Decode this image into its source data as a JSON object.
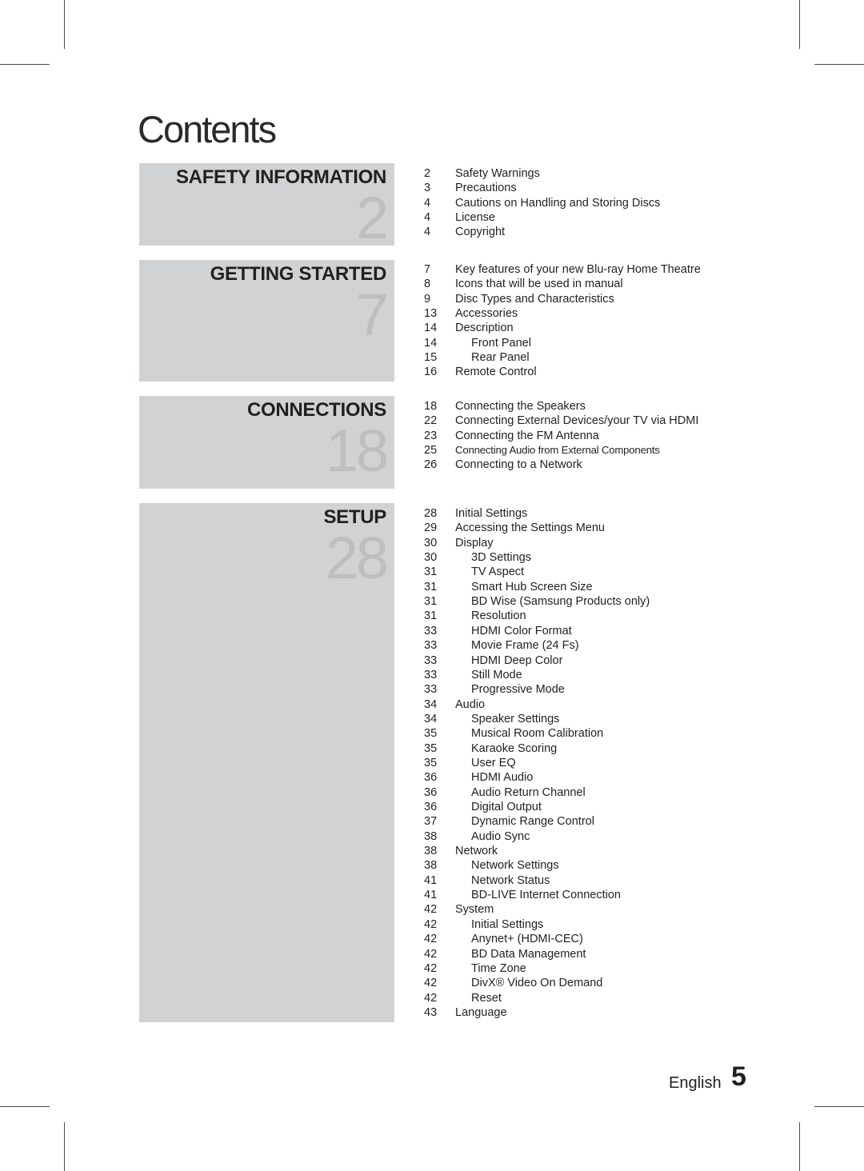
{
  "page": {
    "title": "Contents",
    "footer_language": "English",
    "footer_page_number": "5"
  },
  "sections": [
    {
      "label": "SAFETY INFORMATION",
      "start_page": "2",
      "entries": [
        {
          "page": "2",
          "text": "Safety Warnings",
          "level": 1
        },
        {
          "page": "3",
          "text": "Precautions",
          "level": 1
        },
        {
          "page": "4",
          "text": "Cautions on Handling and Storing Discs",
          "level": 1
        },
        {
          "page": "4",
          "text": "License",
          "level": 1
        },
        {
          "page": "4",
          "text": "Copyright",
          "level": 1
        }
      ]
    },
    {
      "label": "GETTING STARTED",
      "start_page": "7",
      "entries": [
        {
          "page": "7",
          "text": "Key features of your new Blu-ray Home Theatre",
          "level": 1
        },
        {
          "page": "8",
          "text": "Icons that will be used in manual",
          "level": 1
        },
        {
          "page": "9",
          "text": "Disc Types and Characteristics",
          "level": 1
        },
        {
          "page": "13",
          "text": "Accessories",
          "level": 1
        },
        {
          "page": "14",
          "text": "Description",
          "level": 1
        },
        {
          "page": "14",
          "text": "Front Panel",
          "level": 2
        },
        {
          "page": "15",
          "text": "Rear Panel",
          "level": 2
        },
        {
          "page": "16",
          "text": "Remote Control",
          "level": 1
        }
      ]
    },
    {
      "label": "CONNECTIONS",
      "start_page": "18",
      "entries": [
        {
          "page": "18",
          "text": "Connecting the Speakers",
          "level": 1
        },
        {
          "page": "22",
          "text": "Connecting External Devices/your TV via HDMI",
          "level": 1
        },
        {
          "page": "23",
          "text": "Connecting the FM Antenna",
          "level": 1
        },
        {
          "page": "25",
          "text": "Connecting Audio from External Components",
          "level": 1,
          "small": true
        },
        {
          "page": "26",
          "text": "Connecting to a Network",
          "level": 1
        }
      ]
    },
    {
      "label": "SETUP",
      "start_page": "28",
      "entries": [
        {
          "page": "28",
          "text": "Initial Settings",
          "level": 1
        },
        {
          "page": "29",
          "text": "Accessing the Settings Menu",
          "level": 1
        },
        {
          "page": "30",
          "text": "Display",
          "level": 1
        },
        {
          "page": "30",
          "text": "3D Settings",
          "level": 2
        },
        {
          "page": "31",
          "text": "TV Aspect",
          "level": 2
        },
        {
          "page": "31",
          "text": "Smart Hub Screen Size",
          "level": 2
        },
        {
          "page": "31",
          "text": "BD Wise (Samsung Products only)",
          "level": 2
        },
        {
          "page": "31",
          "text": "Resolution",
          "level": 2
        },
        {
          "page": "33",
          "text": "HDMI Color Format",
          "level": 2
        },
        {
          "page": "33",
          "text": "Movie Frame (24 Fs)",
          "level": 2
        },
        {
          "page": "33",
          "text": "HDMI Deep Color",
          "level": 2
        },
        {
          "page": "33",
          "text": "Still Mode",
          "level": 2
        },
        {
          "page": "33",
          "text": "Progressive Mode",
          "level": 2
        },
        {
          "page": "34",
          "text": "Audio",
          "level": 1
        },
        {
          "page": "34",
          "text": "Speaker Settings",
          "level": 2
        },
        {
          "page": "35",
          "text": "Musical Room Calibration",
          "level": 2
        },
        {
          "page": "35",
          "text": "Karaoke Scoring",
          "level": 2
        },
        {
          "page": "35",
          "text": "User EQ",
          "level": 2
        },
        {
          "page": "36",
          "text": "HDMI Audio",
          "level": 2
        },
        {
          "page": "36",
          "text": "Audio Return Channel",
          "level": 2
        },
        {
          "page": "36",
          "text": "Digital Output",
          "level": 2
        },
        {
          "page": "37",
          "text": "Dynamic Range Control",
          "level": 2
        },
        {
          "page": "38",
          "text": "Audio Sync",
          "level": 2
        },
        {
          "page": "38",
          "text": "Network",
          "level": 1
        },
        {
          "page": "38",
          "text": "Network Settings",
          "level": 2
        },
        {
          "page": "41",
          "text": "Network Status",
          "level": 2
        },
        {
          "page": "41",
          "text": "BD-LIVE Internet Connection",
          "level": 2
        },
        {
          "page": "42",
          "text": "System",
          "level": 1
        },
        {
          "page": "42",
          "text": "Initial Settings",
          "level": 2
        },
        {
          "page": "42",
          "text": "Anynet+ (HDMI-CEC)",
          "level": 2
        },
        {
          "page": "42",
          "text": "BD Data Management",
          "level": 2
        },
        {
          "page": "42",
          "text": "Time Zone",
          "level": 2
        },
        {
          "page": "42",
          "text": "DivX® Video On Demand",
          "level": 2
        },
        {
          "page": "42",
          "text": "Reset",
          "level": 2
        },
        {
          "page": "43",
          "text": "Language",
          "level": 1
        }
      ]
    }
  ]
}
